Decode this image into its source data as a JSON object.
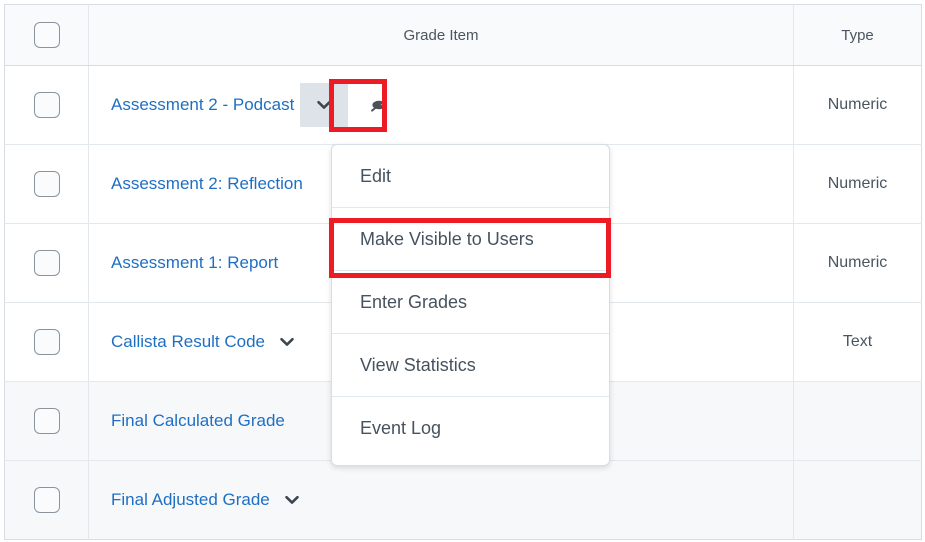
{
  "table": {
    "columns": [
      {
        "key": "select",
        "label": ""
      },
      {
        "key": "grade_item",
        "label": "Grade Item"
      },
      {
        "key": "type",
        "label": "Type"
      }
    ],
    "rows": [
      {
        "name": "Assessment 2 - Podcast",
        "type": "Numeric",
        "has_chevron": true,
        "chevron_active": true,
        "hidden_icon": "eye-slash-icon",
        "shaded": false
      },
      {
        "name": "Assessment 2: Reflection",
        "type": "Numeric",
        "has_chevron": false,
        "chevron_active": false,
        "hidden_icon": "",
        "shaded": false
      },
      {
        "name": "Assessment 1: Report",
        "type": "Numeric",
        "has_chevron": false,
        "chevron_active": false,
        "hidden_icon": "",
        "shaded": false
      },
      {
        "name": "Callista Result Code",
        "type": "Text",
        "has_chevron": true,
        "chevron_active": false,
        "hidden_icon": "",
        "shaded": false
      },
      {
        "name": "Final Calculated Grade",
        "type": "",
        "has_chevron": false,
        "chevron_active": false,
        "hidden_icon": "",
        "shaded": true
      },
      {
        "name": "Final Adjusted Grade",
        "type": "",
        "has_chevron": true,
        "chevron_active": false,
        "hidden_icon": "",
        "shaded": true
      }
    ]
  },
  "context_menu": {
    "open_for_row": "Assessment 2 - Podcast",
    "items": [
      {
        "label": "Edit"
      },
      {
        "label": "Make Visible to Users"
      },
      {
        "label": "Enter Grades"
      },
      {
        "label": "View Statistics"
      },
      {
        "label": "Event Log"
      }
    ],
    "highlighted_item": "Make Visible to Users"
  },
  "annotations": {
    "highlight_color": "#ed1c24",
    "boxes": [
      {
        "name": "chevron-button-highlight",
        "target": "Assessment 2 - Podcast dropdown"
      },
      {
        "name": "menu-item-highlight",
        "target": "Make Visible to Users"
      }
    ]
  },
  "colors": {
    "link": "#1e6fc4",
    "header_bg": "#f9fafb",
    "border": "#e3e8ed",
    "text": "#495561",
    "shaded_row": "#f7f8fa",
    "active_button_bg": "#dde3e9"
  }
}
